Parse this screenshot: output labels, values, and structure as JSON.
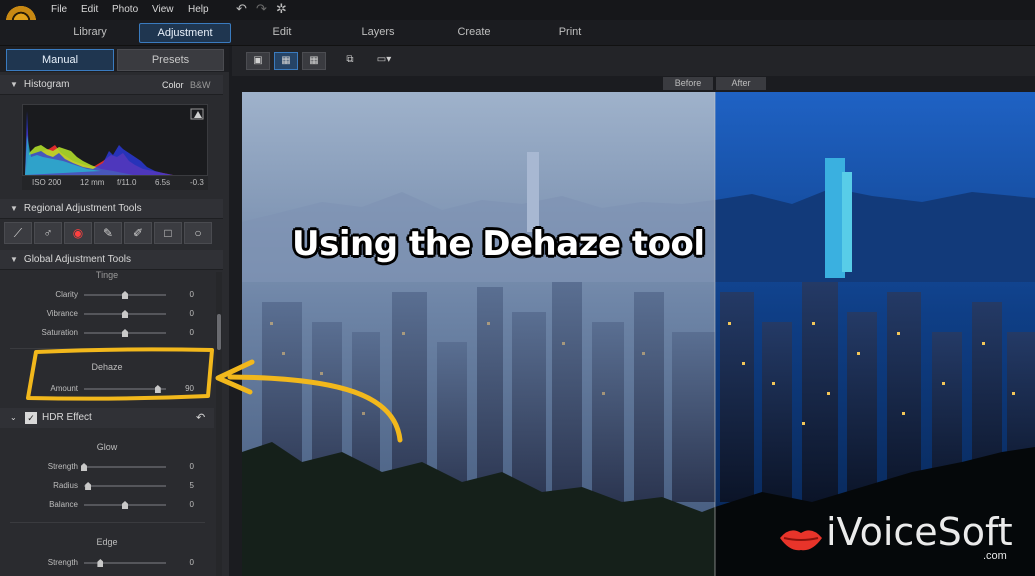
{
  "menu": {
    "items": [
      "File",
      "Edit",
      "Photo",
      "View",
      "Help"
    ]
  },
  "modules": [
    "Library",
    "Adjustment",
    "Edit",
    "Layers",
    "Create",
    "Print"
  ],
  "panel_tabs": {
    "manual": "Manual",
    "presets": "Presets"
  },
  "histogram": {
    "title": "Histogram",
    "mode_color": "Color",
    "mode_bw": "B&W",
    "iso": "ISO 200",
    "focal": "12 mm",
    "aperture": "f/11.0",
    "shutter": "6.5s",
    "ev": "-0.3"
  },
  "regional": {
    "title": "Regional Adjustment Tools",
    "tool_icons": [
      "crop-icon",
      "radial-filter-icon",
      "red-eye-icon",
      "brush-icon",
      "gradient-brush-icon",
      "square-icon",
      "circle-icon"
    ]
  },
  "global": {
    "title": "Global Adjustment Tools",
    "tinge_label": "Tinge",
    "tinge": [
      {
        "label": "Clarity",
        "value": "0",
        "level": 0.5
      },
      {
        "label": "Vibrance",
        "value": "0",
        "level": 0.5
      },
      {
        "label": "Saturation",
        "value": "0",
        "level": 0.5
      }
    ],
    "dehaze_label": "Dehaze",
    "dehaze": {
      "label": "Amount",
      "value": "90",
      "level": 0.9
    },
    "hdr_title": "HDR Effect",
    "glow_label": "Glow",
    "glow": [
      {
        "label": "Strength",
        "value": "0",
        "level": 0.0
      },
      {
        "label": "Radius",
        "value": "5",
        "level": 0.05
      },
      {
        "label": "Balance",
        "value": "0",
        "level": 0.5
      }
    ],
    "edge_label": "Edge",
    "edge": [
      {
        "label": "Strength",
        "value": "0",
        "level": 0.2
      }
    ]
  },
  "view": {
    "before_label": "Before",
    "after_label": "After"
  },
  "overlay": {
    "title": "Using the Dehaze tool"
  },
  "watermark": {
    "brand": "iVoiceSoft",
    "domain": ".com"
  },
  "colors": {
    "accent": "#3a7bbf",
    "annotation": "#f2b81c",
    "panel": "#2a2b2f"
  }
}
